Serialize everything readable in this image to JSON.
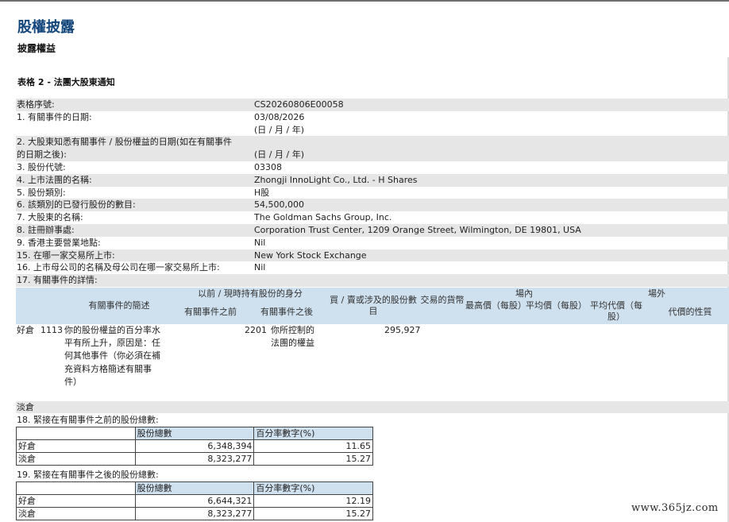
{
  "page": {
    "title": "股權披露",
    "subtitle": "披露權益",
    "section": "表格 2 - 法團大股東通知"
  },
  "fields": [
    {
      "label": "表格序號:",
      "value": "CS20260806E00058"
    },
    {
      "label": "1. 有關事件的日期:",
      "value": "03/08/2026"
    },
    {
      "label": "",
      "value": "(日 / 月 / 年)"
    },
    {
      "label": "2. 大股東知悉有關事件 / 股份權益的日期(如在有關事件",
      "value": ""
    },
    {
      "label": "的日期之後):",
      "value": "(日 / 月 / 年)"
    },
    {
      "label": "3. 股份代號:",
      "value": "03308"
    },
    {
      "label": "4. 上市法團的名稱:",
      "value": "Zhongji InnoLight Co., Ltd. - H Shares"
    },
    {
      "label": "5. 股份類別:",
      "value": "H股"
    },
    {
      "label": "6. 該類別的已發行股份的數目:",
      "value": "54,500,000"
    },
    {
      "label": "7. 大股東的名稱:",
      "value": "The Goldman Sachs Group, Inc."
    },
    {
      "label": "8. 註冊辦事處:",
      "value": "Corporation Trust Center, 1209 Orange Street, Wilmington, DE 19801, USA"
    },
    {
      "label": "9. 香港主要營業地點:",
      "value": "Nil"
    },
    {
      "label": "15. 在哪一家交易所上市:",
      "value": "New York Stock Exchange"
    },
    {
      "label": "16. 上市母公司的名稱及母公司在哪一家交易所上市:",
      "value": "Nil"
    },
    {
      "label": "17. 有關事件的詳情:",
      "value": ""
    }
  ],
  "detail_table": {
    "headers": {
      "event_code": "有關事件的簡述",
      "capacity_group": "以前 / 現時持有股份的身分",
      "before": "有關事件之前",
      "after": "有關事件之後",
      "shares_involved": "買 / 賣或涉及的股份數目",
      "currency": "交易的貨幣",
      "on_exchange": "場內",
      "highest_price": "最高價（每股）",
      "average_price_on": "平均價（每股）",
      "off_exchange": "場外",
      "average_price_off": "平均代價（每股）",
      "consideration": "代價的性質"
    },
    "row": {
      "position": "好倉",
      "event_code": "1113",
      "event_desc": "你的股份權益的百分率水平有所上升，原因是：任何其他事件（你必須在補充資料方格簡述有關事件）",
      "capacity_code": "2201",
      "capacity_desc": "你所控制的法團的權益",
      "shares": "295,927"
    },
    "short_label": "淡倉"
  },
  "summary_before": {
    "title": "18. 緊接在有關事件之前的股份總數:",
    "col_shares": "股份總數",
    "col_pct": "百分率數字(%)",
    "rows": [
      {
        "type": "好倉",
        "shares": "6,348,394",
        "pct": "11.65"
      },
      {
        "type": "淡倉",
        "shares": "8,323,277",
        "pct": "15.27"
      }
    ]
  },
  "summary_after": {
    "title": "19. 緊接在有關事件之後的股份總數:",
    "col_shares": "股份總數",
    "col_pct": "百分率數字(%)",
    "rows": [
      {
        "type": "好倉",
        "shares": "6,644,321",
        "pct": "12.19"
      },
      {
        "type": "淡倉",
        "shares": "8,323,277",
        "pct": "15.27"
      }
    ]
  },
  "watermark": "www.365jz.com"
}
